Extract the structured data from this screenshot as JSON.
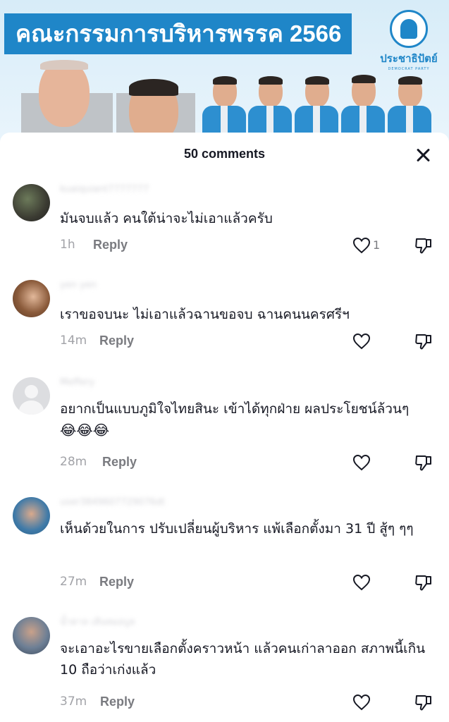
{
  "banner": {
    "title": "คณะกรรมการบริหารพรรค 2566",
    "party_name": "ประชาธิปัตย์",
    "party_subtitle": "DEMOCRAT PARTY"
  },
  "sheet": {
    "title": "50 comments",
    "close_icon": "close-icon"
  },
  "comments": [
    {
      "username": "kuaiquiant7777777",
      "text": "มันจบแล้ว คนใต้น่าจะไม่เอาแล้วครับ",
      "time": "1h",
      "reply_label": "Reply",
      "like_count": "1"
    },
    {
      "username": "yen yen",
      "text": "เราขอจบนะ ไม่เอาแล้วฉานขอจบ ฉานคนนครศรีฯ",
      "time": "14m",
      "reply_label": "Reply",
      "like_count": ""
    },
    {
      "username": "Meffery",
      "text": "อยากเป็นแบบภูมิใจไทยสินะ เข้าได้ทุกฝ่าย ผลประโยชน์ล้วนๆ",
      "emoji": "😂😂😂",
      "time": "28m",
      "reply_label": "Reply",
      "like_count": ""
    },
    {
      "username": "user3849607729076dt",
      "text": "เห็นด้วยในการ ปรับเปลี่ยนผู้บริหาร แพ้เลือกตั้งมา 31 ปี สู้ๆ ๆๆ",
      "time": "27m",
      "reply_label": "Reply",
      "like_count": ""
    },
    {
      "username": "น้ำตาล เส้นหมอบูล",
      "text": "จะเอาอะไรขายเลือกตั้งคราวหน้า แล้วคนเก่าลาออก สภาพนี้เกิน 10 ถือว่าเก่งแล้ว",
      "time": "37m",
      "reply_label": "Reply",
      "like_count": ""
    }
  ],
  "icons": {
    "like": "heart-outline-icon",
    "dislike": "thumbs-down-icon",
    "close": "close-icon"
  },
  "colors": {
    "banner_blue": "#1f86c8",
    "text_primary": "#161823",
    "text_secondary": "#a2a3a8"
  }
}
